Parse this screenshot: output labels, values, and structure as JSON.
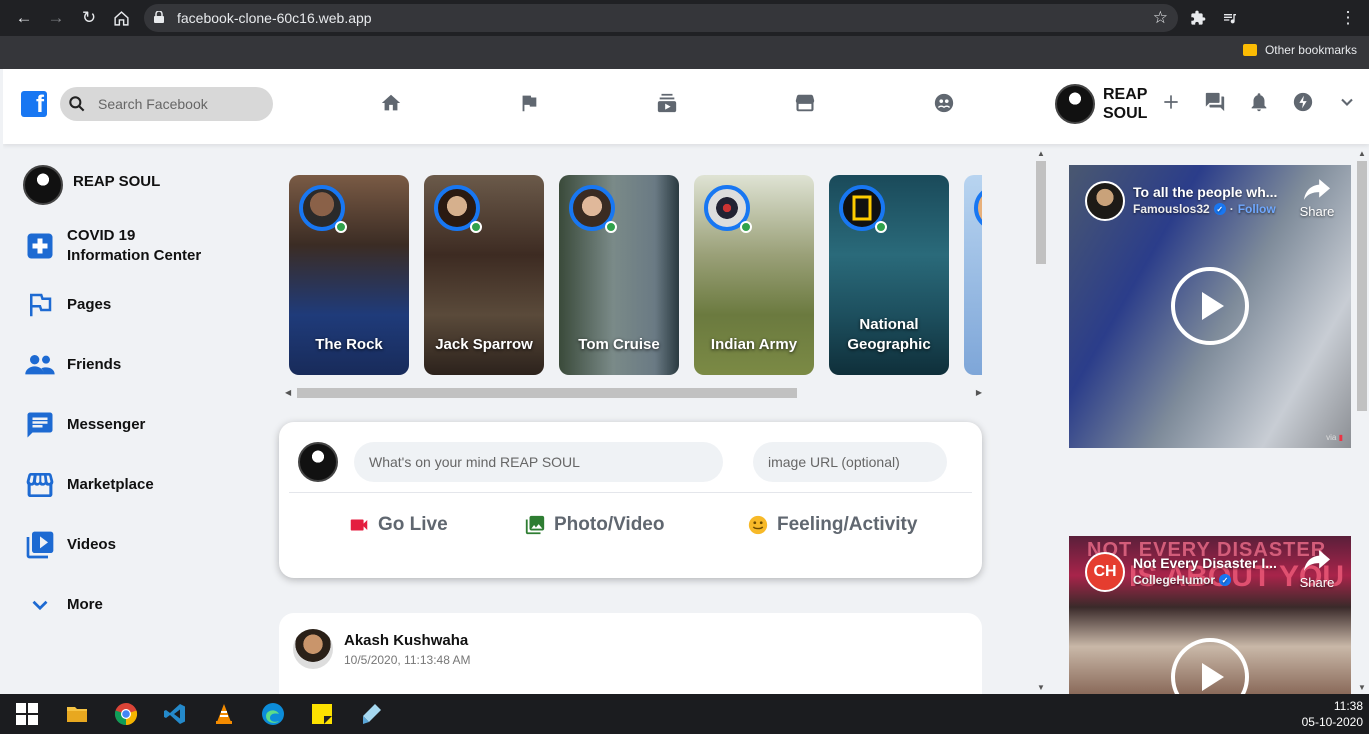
{
  "browser": {
    "url": "facebook-clone-60c16.web.app",
    "bookmark_folder": "Other bookmarks"
  },
  "header": {
    "search_placeholder": "Search Facebook",
    "profile_name": "REAP SOUL",
    "nav_icons": [
      "home-icon",
      "flag-icon",
      "subscriptions-icon",
      "storefront-icon",
      "supervised-user-icon"
    ],
    "action_icons": [
      "add-icon",
      "forum-icon",
      "notifications-icon",
      "storm-icon",
      "expand-more-icon"
    ]
  },
  "sidebar": {
    "profile_name": "REAP SOUL",
    "items": [
      {
        "label_line1": "COVID 19",
        "label_line2": "Information Center",
        "icon": "local-hospital-icon"
      },
      {
        "label": "Pages",
        "icon": "emoji-flags-icon"
      },
      {
        "label": "Friends",
        "icon": "people-icon"
      },
      {
        "label": "Messenger",
        "icon": "chat-icon"
      },
      {
        "label": "Marketplace",
        "icon": "storefront-icon"
      },
      {
        "label": "Videos",
        "icon": "video-library-icon"
      },
      {
        "label": "More",
        "icon": "expand-more-icon"
      }
    ]
  },
  "stories": [
    {
      "name": "The Rock"
    },
    {
      "name": "Jack Sparrow"
    },
    {
      "name": "Tom Cruise"
    },
    {
      "name": "Indian Army"
    },
    {
      "name_line1": "National",
      "name_line2": "Geographic"
    }
  ],
  "composer": {
    "mind_placeholder": "What's on your mind REAP SOUL",
    "image_placeholder": "image URL (optional)",
    "options": [
      {
        "label": "Go Live",
        "color": "#e41e3f",
        "icon": "videocam-icon"
      },
      {
        "label": "Photo/Video",
        "color": "#2e7d32",
        "icon": "photo-library-icon"
      },
      {
        "label": "Feeling/Activity",
        "color": "#f7b928",
        "icon": "insert-emoticon-icon"
      }
    ]
  },
  "post": {
    "author": "Akash Kushwaha",
    "timestamp": "10/5/2020, 11:13:48 AM"
  },
  "videos": [
    {
      "title": "To all the people wh...",
      "channel": "Famouslos32",
      "follow": "Follow",
      "share": "Share",
      "watermark": "via "
    },
    {
      "title": "Not Every Disaster I...",
      "channel": "CollegeHumor",
      "share": "Share",
      "banner_line1": "NOT EVERY DISASTER",
      "banner_line2": "IS ABOUT YOU",
      "channel_logo": "CH"
    }
  ],
  "taskbar": {
    "time": "11:38",
    "date": "05-10-2020"
  },
  "colors": {
    "facebook_blue": "#1877f2",
    "online_green": "#31a24c"
  }
}
